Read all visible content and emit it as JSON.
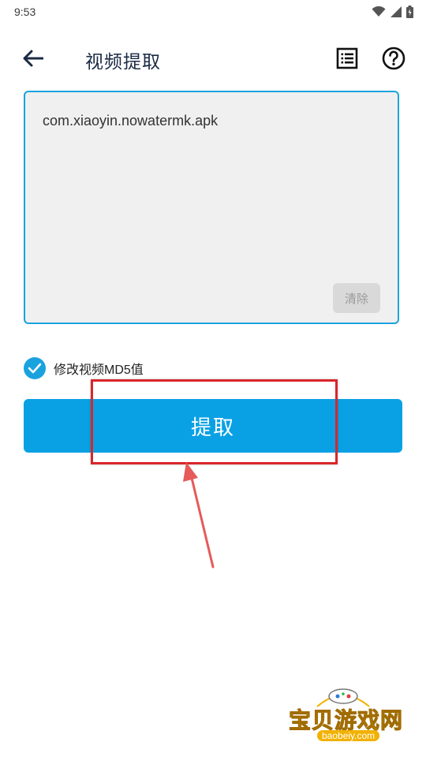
{
  "status_bar": {
    "time": "9:53"
  },
  "app_bar": {
    "title": "视频提取"
  },
  "input": {
    "value": "com.xiaoyin.nowatermk.apk",
    "clear_label": "清除"
  },
  "options": {
    "md5_label": "修改视频MD5值",
    "md5_checked": true
  },
  "actions": {
    "extract_label": "提取"
  },
  "watermark": {
    "brand": "宝贝游戏网",
    "url": "baobeiy.com"
  },
  "colors": {
    "accent": "#0aa1e4",
    "highlight": "#d9262a",
    "title": "#1a2a44"
  },
  "icons": [
    "wifi-icon",
    "signal-icon",
    "battery-icon",
    "back-arrow-icon",
    "list-icon",
    "help-icon",
    "check-icon"
  ]
}
